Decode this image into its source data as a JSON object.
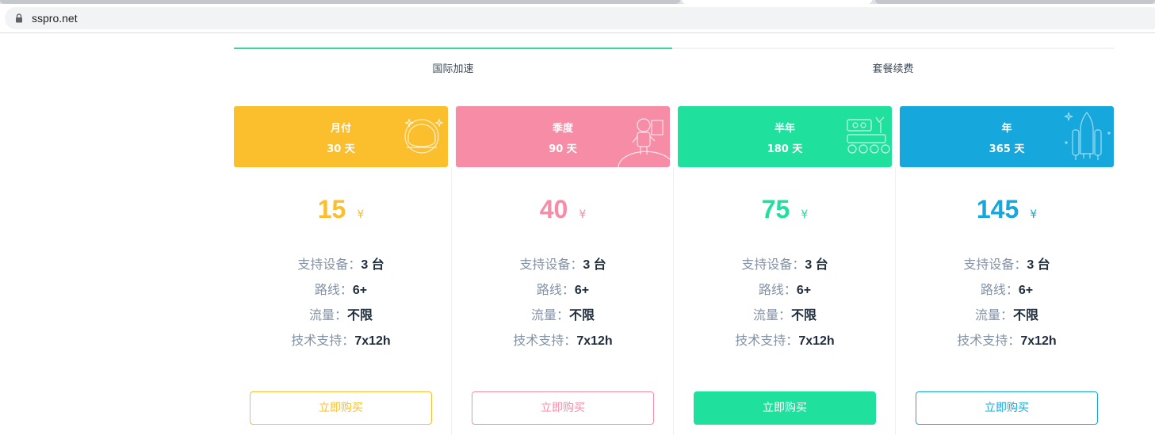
{
  "browser": {
    "url": "sspro.net"
  },
  "tabs": [
    {
      "label": "国际加速",
      "active": true
    },
    {
      "label": "套餐续费",
      "active": false
    }
  ],
  "labels": {
    "devices": "支持设备：",
    "routes": "路线：",
    "traffic": "流量：",
    "support": "技术支持：",
    "buy": "立即购买"
  },
  "plans": [
    {
      "name": "月付",
      "days": "30 天",
      "price": "15",
      "currency": "¥",
      "color": "#fbbe2d",
      "icon": "astronaut-helmet-icon",
      "devices": "3 台",
      "routes": "6+",
      "traffic": "不限",
      "support": "7x12h",
      "button_filled": false
    },
    {
      "name": "季度",
      "days": "90 天",
      "price": "40",
      "currency": "¥",
      "color": "#f78ca7",
      "icon": "astronaut-icon",
      "devices": "3 台",
      "routes": "6+",
      "traffic": "不限",
      "support": "7x12h",
      "button_filled": false
    },
    {
      "name": "半年",
      "days": "180 天",
      "price": "75",
      "currency": "¥",
      "color": "#20e09e",
      "icon": "rover-icon",
      "devices": "3 台",
      "routes": "6+",
      "traffic": "不限",
      "support": "7x12h",
      "button_filled": true
    },
    {
      "name": "年",
      "days": "365 天",
      "price": "145",
      "currency": "¥",
      "color": "#16a8dc",
      "icon": "rocket-icon",
      "devices": "3 台",
      "routes": "6+",
      "traffic": "不限",
      "support": "7x12h",
      "button_filled": false
    }
  ]
}
